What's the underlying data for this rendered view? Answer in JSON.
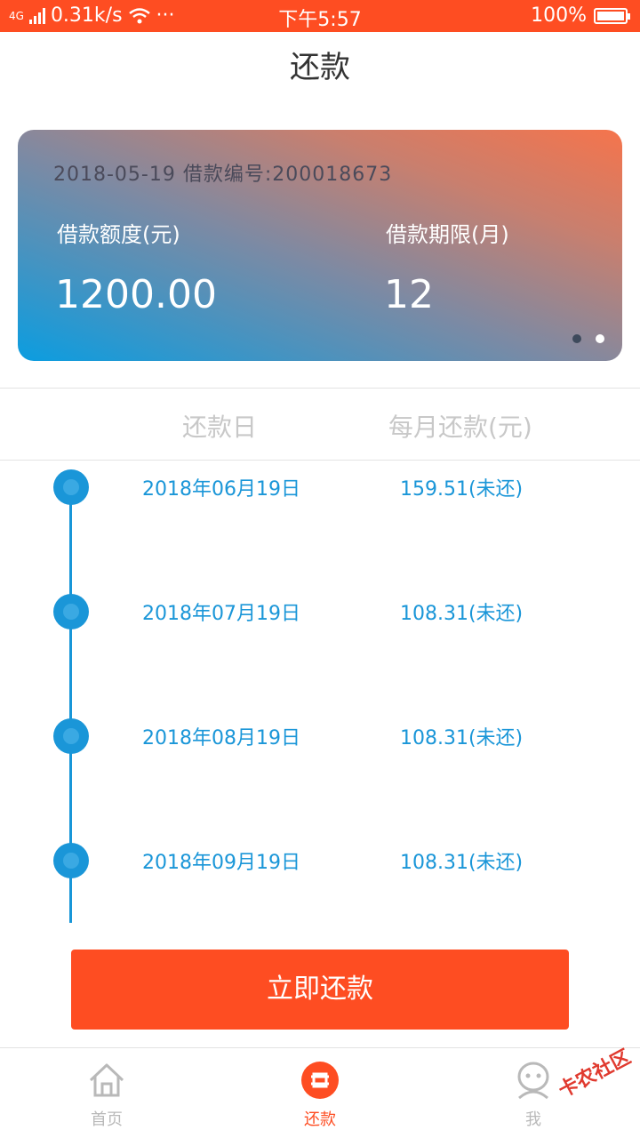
{
  "status_bar": {
    "network": "4G",
    "speed": "0.31k/s",
    "more": "···",
    "time": "下午5:57",
    "battery": "100%"
  },
  "header": {
    "title": "还款"
  },
  "loan_card": {
    "meta": "2018-05-19 借款编号:200018673",
    "amount_label": "借款额度(元)",
    "amount_value": "1200.00",
    "term_label": "借款期限(月)",
    "term_value": "12"
  },
  "table": {
    "col_date": "还款日",
    "col_amount": "每月还款(元)"
  },
  "schedule": [
    {
      "date": "2018年06月19日",
      "amount": "159.51(未还)"
    },
    {
      "date": "2018年07月19日",
      "amount": "108.31(未还)"
    },
    {
      "date": "2018年08月19日",
      "amount": "108.31(未还)"
    },
    {
      "date": "2018年09月19日",
      "amount": "108.31(未还)"
    }
  ],
  "pay_button": {
    "label": "立即还款"
  },
  "tabbar": {
    "items": [
      {
        "label": "首页",
        "icon": "home-icon"
      },
      {
        "label": "还款",
        "icon": "repay-icon"
      },
      {
        "label": "我",
        "icon": "user-icon"
      }
    ]
  },
  "watermark": "卡农社区",
  "colors": {
    "accent": "#fe4d22",
    "primary_blue": "#1a96d8"
  }
}
